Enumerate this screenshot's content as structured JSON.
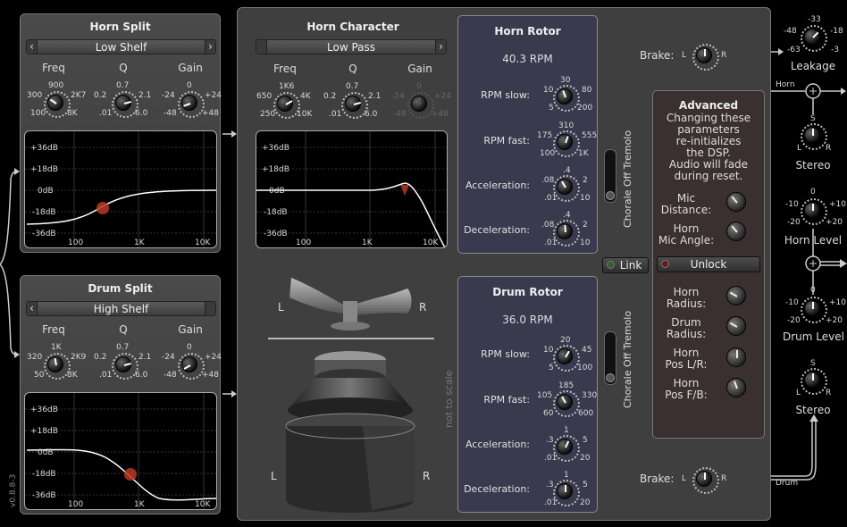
{
  "horn_split": {
    "title": "Horn Split",
    "filter": "Low Shelf",
    "freq_label": "Freq",
    "q_label": "Q",
    "gain_label": "Gain",
    "freq_ticks": [
      "900",
      "300",
      "2K7",
      "100",
      "8K"
    ],
    "q_ticks": [
      "0.7",
      "0.2",
      "2.1",
      ".01",
      "6.0"
    ],
    "gain_ticks": [
      "0",
      "-24",
      "+24",
      "-48",
      "+48"
    ],
    "graph_db": [
      "+36dB",
      "+18dB",
      "0dB",
      "-18dB",
      "-36dB"
    ],
    "graph_hz": [
      "100",
      "1K",
      "10K"
    ]
  },
  "drum_split": {
    "title": "Drum Split",
    "filter": "High Shelf",
    "freq_label": "Freq",
    "q_label": "Q",
    "gain_label": "Gain",
    "freq_ticks": [
      "1K",
      "320",
      "2K9",
      "50",
      "8K"
    ],
    "q_ticks": [
      "0.7",
      "0.2",
      "2.1",
      ".01",
      "6.0"
    ],
    "gain_ticks": [
      "0",
      "-24",
      "+24",
      "-48",
      "+48"
    ],
    "graph_db": [
      "+36dB",
      "+18dB",
      "0dB",
      "-18dB",
      "-36dB"
    ],
    "graph_hz": [
      "100",
      "1K",
      "10K"
    ]
  },
  "horn_character": {
    "title": "Horn Character",
    "filter": "Low Pass",
    "freq_label": "Freq",
    "q_label": "Q",
    "gain_label": "Gain",
    "freq_ticks": [
      "1K6",
      "650",
      "4K",
      "250",
      "10K"
    ],
    "q_ticks": [
      "0.7",
      "0.2",
      "2.1",
      ".01",
      "6.0"
    ],
    "gain_ticks": [
      "0",
      "-24",
      "+24",
      "-48",
      "+48"
    ],
    "graph_db": [
      "+36dB",
      "+18dB",
      "0dB",
      "-18dB",
      "-36dB"
    ],
    "graph_hz": [
      "100",
      "1K",
      "10K"
    ]
  },
  "horn_rotor": {
    "title": "Horn Rotor",
    "rpm": "40.3 RPM",
    "slow_label": "RPM slow:",
    "slow_ticks": [
      "30",
      "10",
      "80",
      "5",
      "200"
    ],
    "fast_label": "RPM fast:",
    "fast_ticks": [
      "310",
      "175",
      "555",
      "100",
      "1K"
    ],
    "accel_label": "Acceleration:",
    "accel_ticks": [
      ".4",
      ".08",
      "2",
      ".01",
      "10"
    ],
    "decel_label": "Deceleration:",
    "decel_ticks": [
      ".4",
      ".08",
      "2",
      ".01",
      "10"
    ],
    "mode": "Chorale  Off  Tremolo"
  },
  "drum_rotor": {
    "title": "Drum Rotor",
    "rpm": "36.0 RPM",
    "slow_label": "RPM slow:",
    "slow_ticks": [
      "20",
      "10",
      "45",
      "5",
      "100"
    ],
    "fast_label": "RPM fast:",
    "fast_ticks": [
      "185",
      "105",
      "330",
      "60",
      "600"
    ],
    "accel_label": "Acceleration:",
    "accel_ticks": [
      "1",
      ".3",
      "5",
      ".01",
      "20"
    ],
    "decel_label": "Deceleration:",
    "decel_ticks": [
      "1",
      ".3",
      "5",
      ".01",
      "20"
    ],
    "mode": "Chorale  Off  Tremolo"
  },
  "speaker": {
    "left": "L",
    "right": "R",
    "note": "not to scale"
  },
  "link_label": "Link",
  "unlock_label": "Unlock",
  "brake": {
    "label": "Brake:",
    "l": "L",
    "r": "R"
  },
  "advanced": {
    "title": "Advanced",
    "desc": [
      "Changing these",
      "parameters",
      "re-initializes",
      "the DSP.",
      "Audio will fade",
      "during reset."
    ],
    "mic_distance": [
      "Mic",
      "Distance:"
    ],
    "horn_mic_angle": [
      "Horn",
      "Mic Angle:"
    ],
    "horn_radius": [
      "Horn",
      "Radius:"
    ],
    "drum_radius": [
      "Drum",
      "Radius:"
    ],
    "horn_pos_lr": [
      "Horn",
      "Pos L/R:"
    ],
    "horn_pos_fb": [
      "Horn",
      "Pos F/B:"
    ]
  },
  "right_column": {
    "leakage_ticks": [
      "-33",
      "-48",
      "-18",
      "-63",
      "-3"
    ],
    "leakage_label": "Leakage",
    "horn_tag": "Horn",
    "drum_tag": "Drum",
    "stereo_label": "Stereo",
    "s_tick": "S",
    "l_tick": "L",
    "r_tick": "R",
    "level_ticks": [
      "0",
      "-10",
      "+10",
      "-20",
      "+20"
    ],
    "horn_level": "Horn Level",
    "drum_level": "Drum Level"
  },
  "version": "v0.8.8-3",
  "colors": {
    "panel": "#414141",
    "rotor": "#3a3a4e",
    "advanced": "#3a3030",
    "curve": "#ffffff",
    "handle": "#c0442a"
  }
}
